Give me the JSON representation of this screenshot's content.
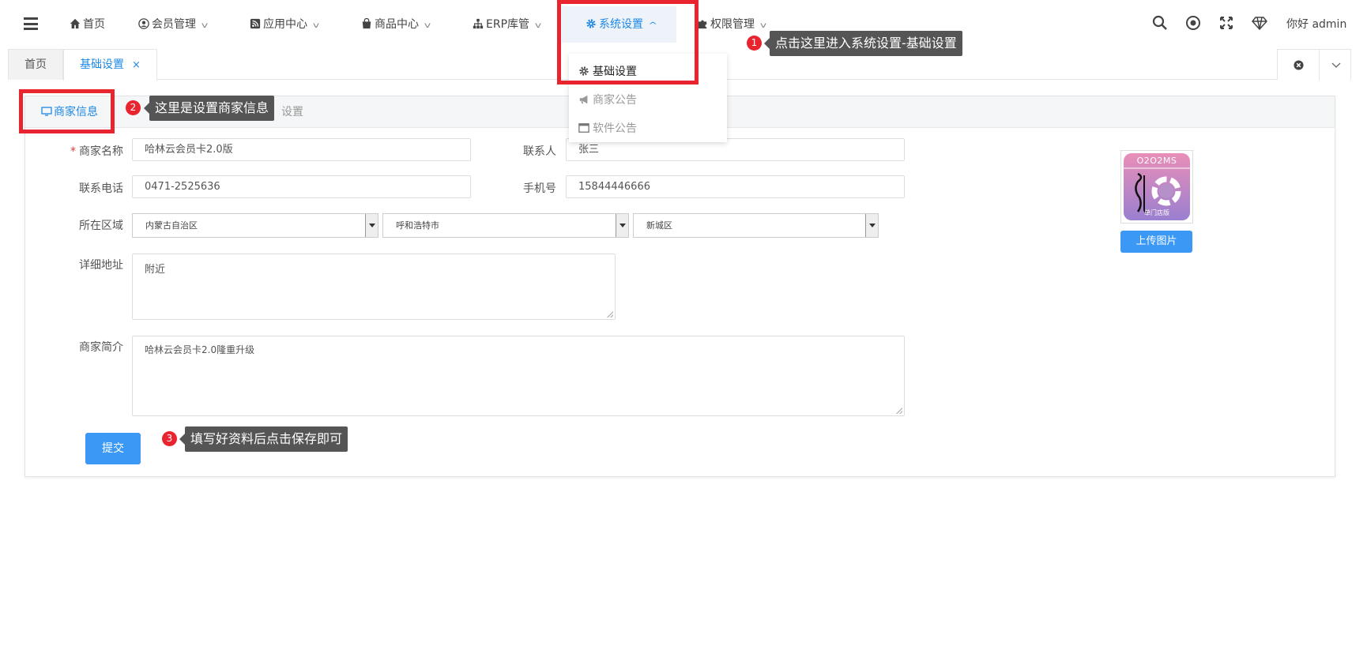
{
  "nav": {
    "home": "首页",
    "members": "会员管理",
    "apps": "应用中心",
    "products": "商品中心",
    "erp": "ERP库管",
    "system": "系统设置",
    "permissions": "权限管理",
    "greeting": "你好 admin"
  },
  "tabs": [
    {
      "label": "首页"
    },
    {
      "label": "基础设置",
      "close": "×"
    }
  ],
  "dropdown": {
    "items": [
      {
        "label": "基础设置",
        "icon": "gear-icon"
      },
      {
        "label": "商家公告",
        "icon": "megaphone-icon"
      },
      {
        "label": "软件公告",
        "icon": "window-icon"
      }
    ]
  },
  "subtabs": {
    "merchant_info": "商家信息",
    "other_partial": "设置"
  },
  "form": {
    "merchant_name": {
      "label": "商家名称",
      "required_mark": "*",
      "value": "哈林云会员卡2.0版"
    },
    "contact": {
      "label": "联系人",
      "value": "张三"
    },
    "phone": {
      "label": "联系电话",
      "value": "0471-2525636"
    },
    "mobile": {
      "label": "手机号",
      "value": "15844446666"
    },
    "region": {
      "label": "所在区域",
      "province": "内蒙古自治区",
      "city": "呼和浩特市",
      "district": "新城区"
    },
    "address": {
      "label": "详细地址",
      "value": "附近"
    },
    "intro": {
      "label": "商家简介",
      "value": "哈林云会员卡2.0隆重升级"
    },
    "submit": "提交"
  },
  "logo": {
    "top_text": "O2O2MS",
    "bottom_text": "单门店版",
    "upload_button": "上传图片"
  },
  "annotations": [
    {
      "number": "1",
      "text": "点击这里进入系统设置-基础设置"
    },
    {
      "number": "2",
      "text": "这里是设置商家信息"
    },
    {
      "number": "3",
      "text": "填写好资料后点击保存即可"
    }
  ],
  "colors": {
    "accent": "#1e88e5",
    "button": "#3b99f5",
    "annotation_red": "#e8242f",
    "tooltip_bg": "#555555"
  }
}
